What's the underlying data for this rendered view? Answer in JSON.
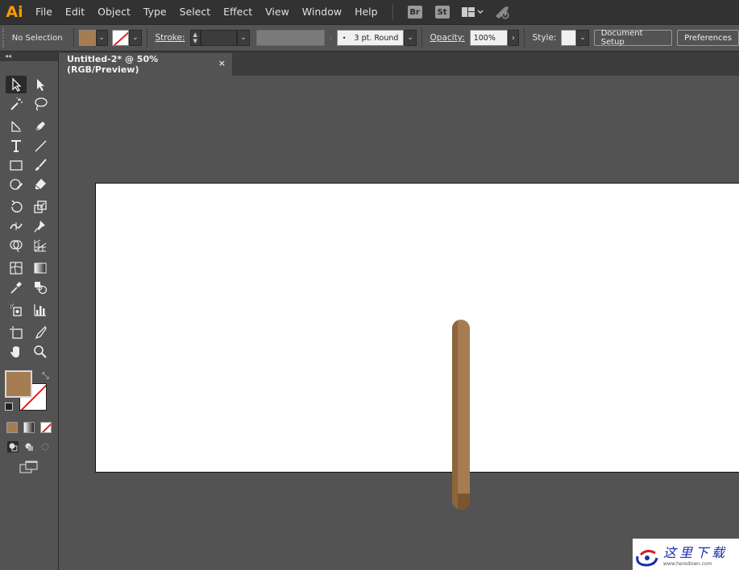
{
  "app": {
    "logo": "Ai"
  },
  "menu": [
    "File",
    "Edit",
    "Object",
    "Type",
    "Select",
    "Effect",
    "View",
    "Window",
    "Help"
  ],
  "menu_badges": {
    "bridge": "Br",
    "stock": "St"
  },
  "control": {
    "selection": "No Selection",
    "stroke_label": "Stroke:",
    "brush_dot": "•",
    "brush": "3 pt. Round",
    "opacity_label": "Opacity:",
    "opacity": "100%",
    "style_label": "Style:",
    "document_setup": "Document Setup",
    "preferences": "Preferences"
  },
  "tools_header": "◂◂",
  "document": {
    "tab_title": "Untitled-2* @ 50% (RGB/Preview)",
    "close": "×"
  },
  "colors": {
    "fill": "#a67c52",
    "none_stroke": "#e02020",
    "accent": "#ff9a00"
  },
  "watermark": {
    "cn": "这里下载",
    "url": "www.heredown.com"
  }
}
